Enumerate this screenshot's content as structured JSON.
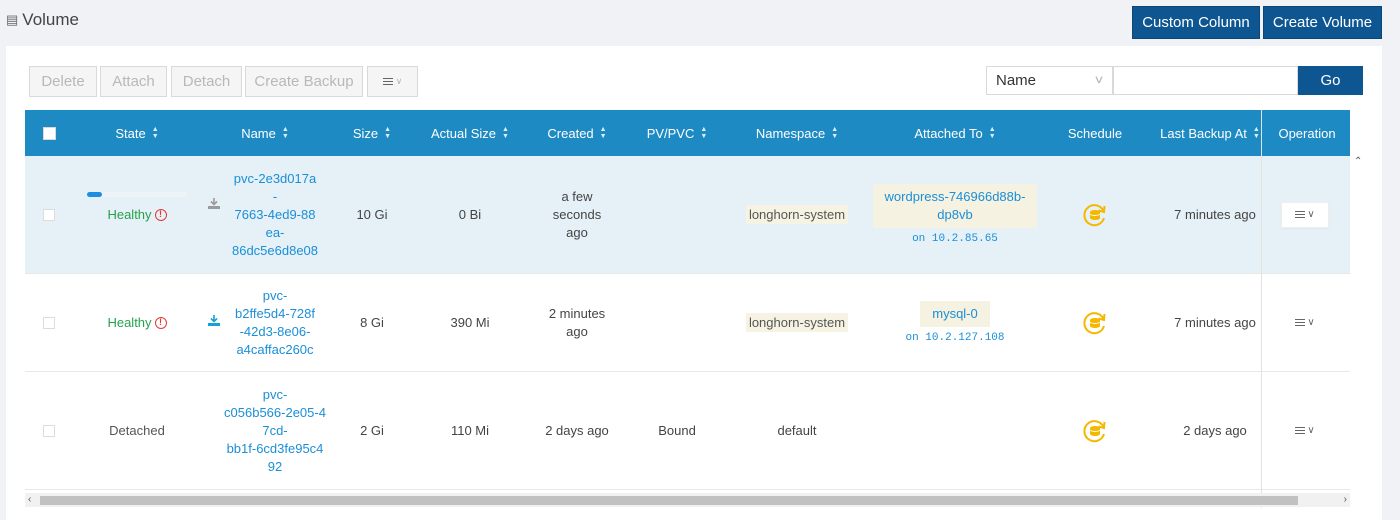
{
  "header": {
    "title": "Volume",
    "custom_column_label": "Custom Column",
    "create_volume_label": "Create Volume"
  },
  "toolbar": {
    "delete_label": "Delete",
    "attach_label": "Attach",
    "detach_label": "Detach",
    "create_backup_label": "Create Backup",
    "more_icon": "list-icon"
  },
  "search": {
    "field_selected": "Name",
    "value": "",
    "go_label": "Go"
  },
  "table": {
    "columns": [
      "State",
      "Name",
      "Size",
      "Actual Size",
      "Created",
      "PV/PVC",
      "Namespace",
      "Attached To",
      "Schedule",
      "Last Backup At",
      "Operation"
    ],
    "rows": [
      {
        "state": "Healthy",
        "state_warning": true,
        "rebuild_progress": 0.15,
        "name_lines": [
          "pvc-2e3d017a",
          "-",
          "7663-4ed9-88",
          "ea-",
          "86dc5e6d8e08"
        ],
        "size": "10 Gi",
        "actual_size": "0 Bi",
        "created_lines": [
          "a few",
          "seconds",
          "ago"
        ],
        "pv_pvc": "",
        "namespace": "longhorn-system",
        "attached_to_lines": [
          "wordpress-746966d88b-",
          "dp8vb"
        ],
        "attached_ip": "on 10.2.85.65",
        "last_backup": "7 minutes ago"
      },
      {
        "state": "Healthy",
        "state_warning": true,
        "name_lines": [
          "pvc-",
          "b2ffe5d4-728f",
          "-42d3-8e06-",
          "a4caffac260c"
        ],
        "size": "8 Gi",
        "actual_size": "390 Mi",
        "created_lines": [
          "2 minutes",
          "ago"
        ],
        "pv_pvc": "",
        "namespace": "longhorn-system",
        "attached_to_lines": [
          "mysql-0"
        ],
        "attached_ip": "on 10.2.127.108",
        "last_backup": "7 minutes ago"
      },
      {
        "state": "Detached",
        "state_warning": false,
        "name_lines": [
          "pvc-",
          "c056b566-2e05-4",
          "7cd-",
          "bb1f-6cd3fe95c4",
          "92"
        ],
        "size": "2 Gi",
        "actual_size": "110 Mi",
        "created_lines": [
          "2 days ago"
        ],
        "pv_pvc": "Bound",
        "namespace": "default",
        "attached_to_lines": [],
        "attached_ip": "",
        "last_backup": "2 days ago"
      }
    ]
  },
  "colors": {
    "primary": "#0e5691",
    "table_header": "#1e8ac3",
    "healthy": "#27a04d",
    "warning": "#e53935",
    "link": "#1a8fd8",
    "schedule_icon": "#f5b800"
  }
}
